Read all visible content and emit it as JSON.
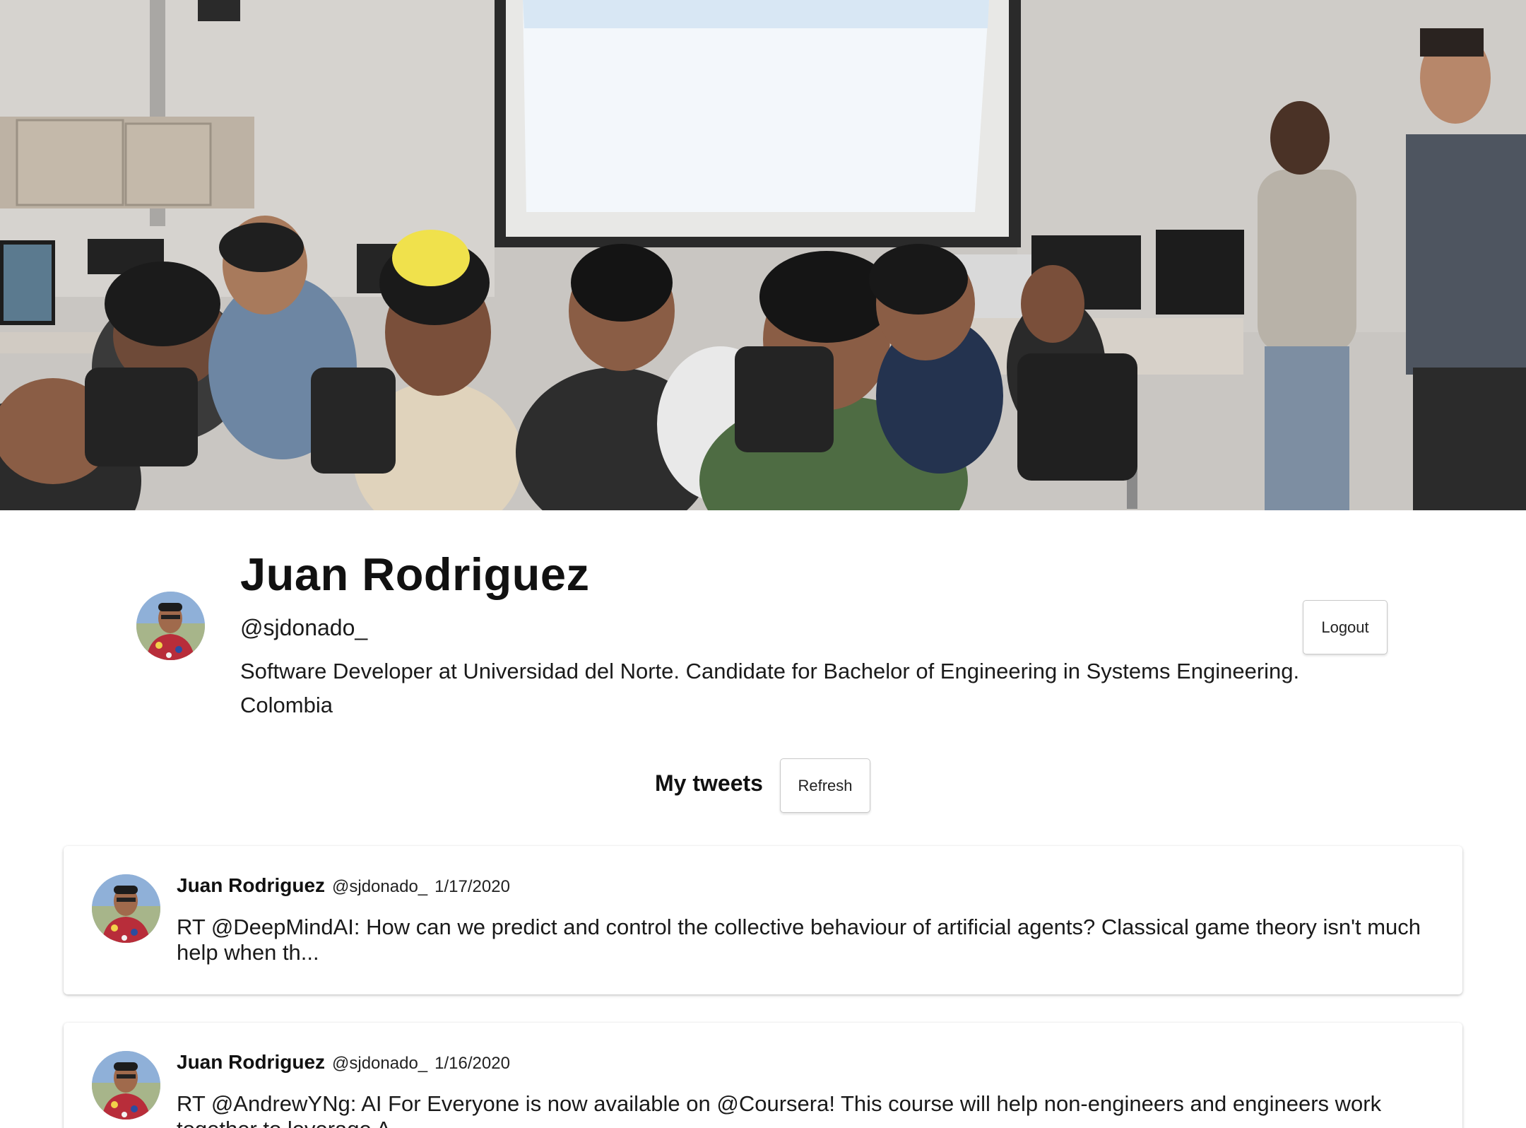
{
  "cover": {
    "image": "cover-photo-classroom-presentation"
  },
  "profile": {
    "name": "Juan Rodriguez",
    "handle": "@sjdonado_",
    "bio": "Software Developer at Universidad del Norte. Candidate for Bachelor of Engineering in Systems Engineering.",
    "location": "Colombia",
    "avatar": "profile-avatar"
  },
  "actions": {
    "logout_label": "Logout",
    "refresh_label": "Refresh"
  },
  "tweets_section": {
    "title": "My tweets"
  },
  "tweets": [
    {
      "author": "Juan Rodriguez",
      "handle": "@sjdonado_",
      "date": "1/17/2020",
      "text": "RT @DeepMindAI: How can we predict and control the collective behaviour of artificial agents? Classical game theory isn't much help when th..."
    },
    {
      "author": "Juan Rodriguez",
      "handle": "@sjdonado_",
      "date": "1/16/2020",
      "text": "RT @AndrewYNg: AI For Everyone is now available on @Coursera! This course will help non-engineers and engineers work together to leverage A..."
    }
  ]
}
